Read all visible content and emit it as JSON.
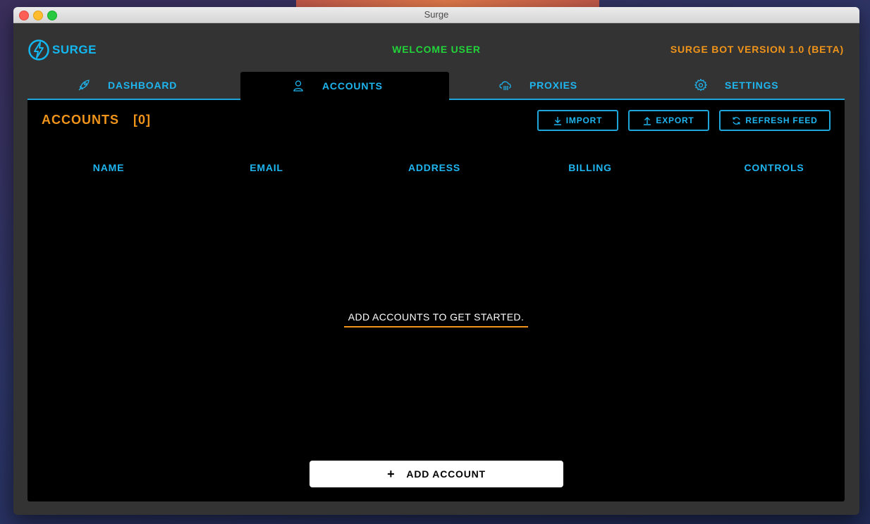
{
  "window": {
    "title": "Surge"
  },
  "header": {
    "logo_text": "SURGE",
    "welcome": "WELCOME USER",
    "version": "SURGE BOT VERSION 1.0 (BETA)"
  },
  "tabs": [
    {
      "label": "DASHBOARD",
      "icon": "rocket-icon"
    },
    {
      "label": "ACCOUNTS",
      "icon": "user-icon",
      "active": true
    },
    {
      "label": "PROXIES",
      "icon": "cloud-icon"
    },
    {
      "label": "SETTINGS",
      "icon": "gear-icon"
    }
  ],
  "accounts": {
    "title": "ACCOUNTS",
    "count": "[0]",
    "buttons": {
      "import": "IMPORT",
      "export": "EXPORT",
      "refresh": "REFRESH FEED"
    },
    "columns": [
      "NAME",
      "EMAIL",
      "ADDRESS",
      "BILLING",
      "CONTROLS"
    ],
    "empty_message": "ADD ACCOUNTS TO GET STARTED.",
    "add_button": "ADD ACCOUNT"
  },
  "colors": {
    "accent_blue": "#1fb5ef",
    "accent_orange": "#f0941a",
    "welcome_green": "#22d33a"
  }
}
